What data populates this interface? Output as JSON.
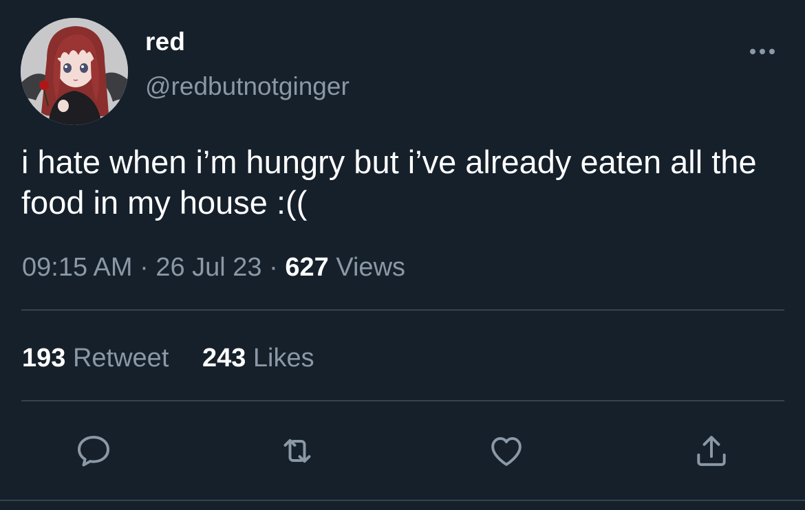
{
  "user": {
    "display_name": "red",
    "handle": "@redbutnotginger",
    "avatar_icon": "anime-avatar-icon"
  },
  "menu": {
    "more_icon": "more-dots-icon"
  },
  "tweet": {
    "text": "i hate when i’m hungry but i’ve already eaten all the food in my house :(("
  },
  "meta": {
    "time": "09:15 AM",
    "sep1": "·",
    "date": "26 Jul 23",
    "sep2": "·",
    "views_count": "627",
    "views_label": "Views"
  },
  "stats": {
    "retweets_count": "193",
    "retweets_label": "Retweet",
    "likes_count": "243",
    "likes_label": "Likes"
  },
  "actions": [
    {
      "name": "reply",
      "icon": "reply-icon"
    },
    {
      "name": "retweet",
      "icon": "retweet-icon"
    },
    {
      "name": "like",
      "icon": "heart-icon"
    },
    {
      "name": "share",
      "icon": "share-icon"
    }
  ],
  "colors": {
    "background": "#15202b",
    "text": "#ffffff",
    "secondary_text": "#8b98a5",
    "divider": "#38444d",
    "icon": "#8b98a5"
  }
}
